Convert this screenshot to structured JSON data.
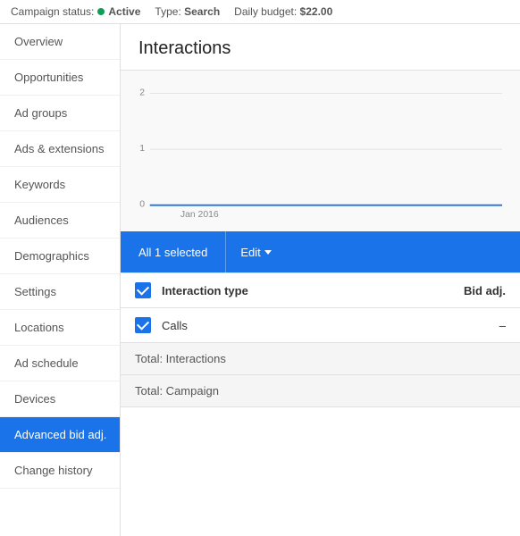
{
  "topbar": {
    "campaign_status_label": "Campaign status:",
    "status_value": "Active",
    "type_label": "Type:",
    "type_value": "Search",
    "budget_label": "Daily budget:",
    "budget_value": "$22.00"
  },
  "sidebar": {
    "items": [
      {
        "id": "overview",
        "label": "Overview",
        "active": false
      },
      {
        "id": "opportunities",
        "label": "Opportunities",
        "active": false
      },
      {
        "id": "ad-groups",
        "label": "Ad groups",
        "active": false
      },
      {
        "id": "ads-extensions",
        "label": "Ads & extensions",
        "active": false
      },
      {
        "id": "keywords",
        "label": "Keywords",
        "active": false
      },
      {
        "id": "audiences",
        "label": "Audiences",
        "active": false
      },
      {
        "id": "demographics",
        "label": "Demographics",
        "active": false
      },
      {
        "id": "settings",
        "label": "Settings",
        "active": false
      },
      {
        "id": "locations",
        "label": "Locations",
        "active": false
      },
      {
        "id": "ad-schedule",
        "label": "Ad schedule",
        "active": false
      },
      {
        "id": "devices",
        "label": "Devices",
        "active": false
      },
      {
        "id": "advanced-bid",
        "label": "Advanced bid adj.",
        "active": true
      },
      {
        "id": "change-history",
        "label": "Change history",
        "active": false
      }
    ]
  },
  "content": {
    "title": "Interactions",
    "chart": {
      "y_labels": [
        "2",
        "1",
        "0"
      ],
      "x_label": "Jan 2016"
    },
    "toolbar": {
      "selected_label": "All 1 selected",
      "edit_label": "Edit"
    },
    "table": {
      "headers": {
        "type_col": "Interaction type",
        "bid_col": "Bid adj."
      },
      "rows": [
        {
          "type": "Calls",
          "bid": "–"
        }
      ],
      "footers": [
        {
          "label": "Total: Interactions"
        },
        {
          "label": "Total: Campaign"
        }
      ]
    }
  }
}
